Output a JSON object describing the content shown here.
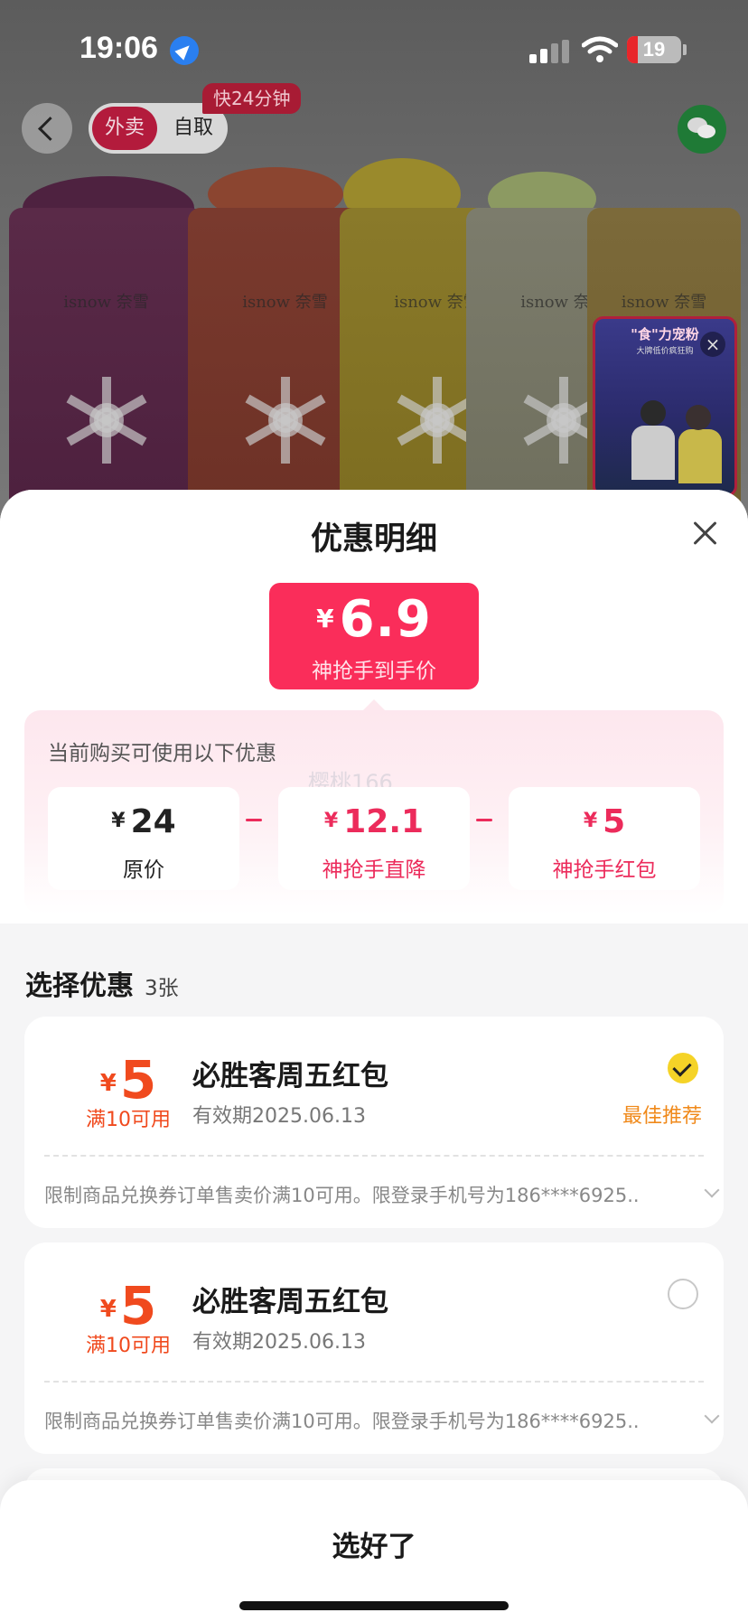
{
  "status_bar": {
    "time": "19:06",
    "battery": "19"
  },
  "nav": {
    "tab_delivery": "外卖",
    "tab_pickup": "自取",
    "fast_tag": "快24分钟"
  },
  "background": {
    "brand_text": "isnow 奈雪"
  },
  "live": {
    "title": "\"食\"力宠粉",
    "subtitle": "大牌低价疯狂购",
    "close": "×"
  },
  "sheet": {
    "title": "优惠明细",
    "final_price": {
      "currency": "¥",
      "amount": "6.9",
      "label": "神抢手到手价"
    },
    "calc": {
      "title": "当前购买可使用以下优惠",
      "watermark": "樱桃166",
      "items": [
        {
          "currency": "¥",
          "value": "24",
          "label": "原价"
        },
        {
          "currency": "¥",
          "value": "12.1",
          "label": "神抢手直降"
        },
        {
          "currency": "¥",
          "value": "5",
          "label": "神抢手红包"
        }
      ]
    },
    "choose": {
      "title": "选择优惠",
      "count": "3张"
    },
    "coupons": [
      {
        "currency": "¥",
        "amount": "5",
        "condition": "满10可用",
        "name": "必胜客周五红包",
        "validity": "有效期2025.06.13",
        "selected": true,
        "tag": "最佳推荐",
        "desc": "限制商品兑换券订单售卖价满10可用。限登录手机号为186****6925..."
      },
      {
        "currency": "¥",
        "amount": "5",
        "condition": "满10可用",
        "name": "必胜客周五红包",
        "validity": "有效期2025.06.13",
        "selected": false,
        "desc": "限制商品兑换券订单售卖价满10可用。限登录手机号为186****6925..."
      }
    ],
    "confirm_label": "选好了"
  },
  "colors": {
    "accent": "#fa2d5a",
    "coupon_orange": "#f04a1e",
    "best_tag": "#f0891a",
    "check_yellow": "#f5d327"
  }
}
